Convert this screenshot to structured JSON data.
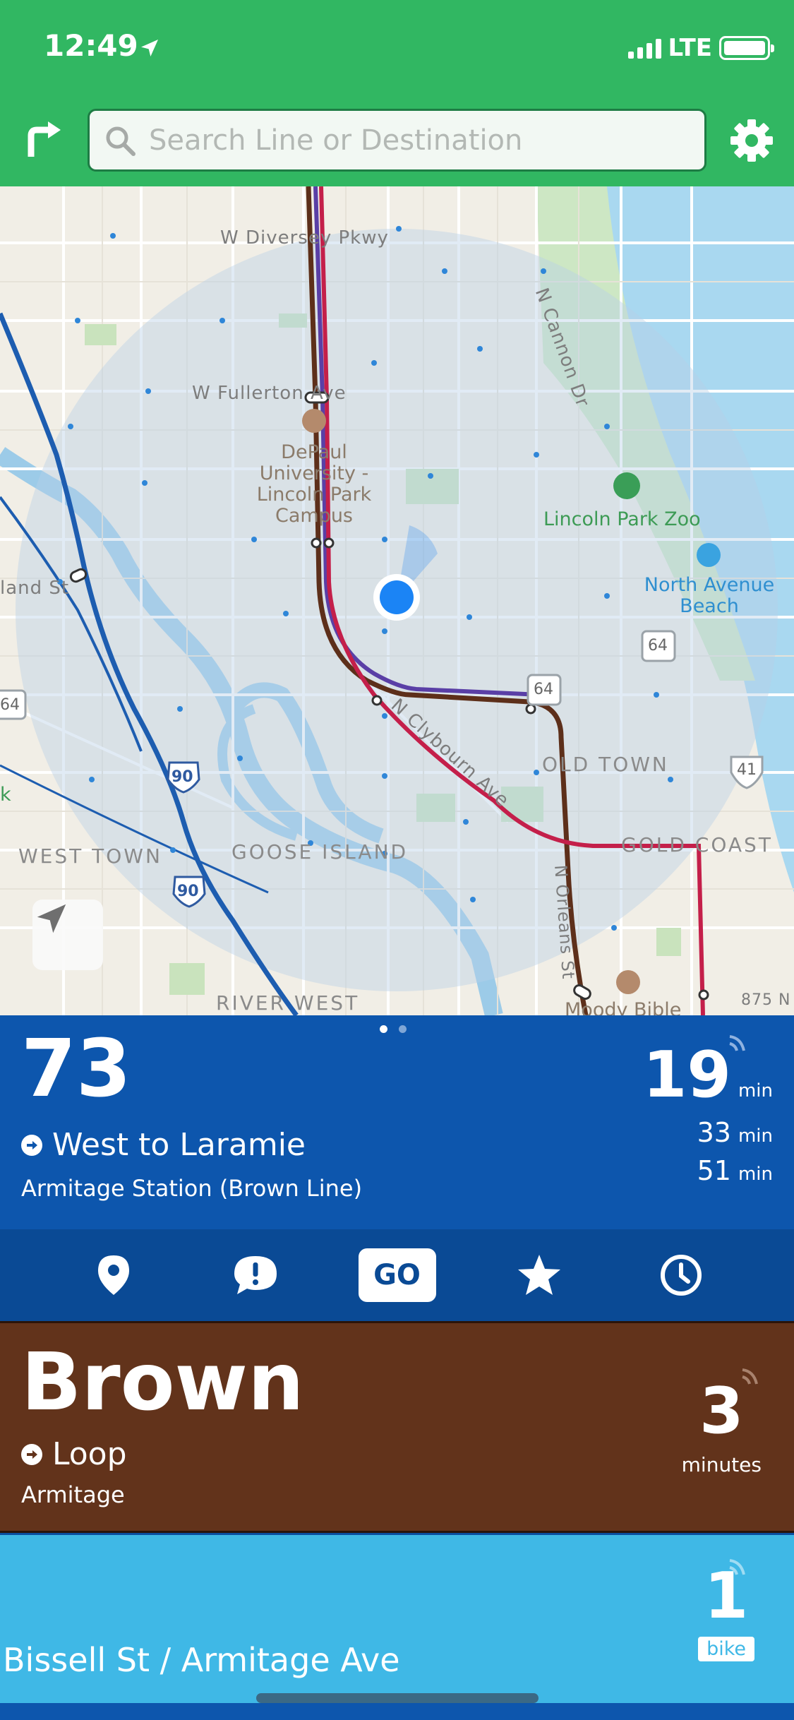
{
  "status_bar": {
    "time": "12:49",
    "network": "LTE"
  },
  "header": {
    "search_placeholder": "Search Line or Destination"
  },
  "map": {
    "street_labels": [
      "W Diversey Pkwy",
      "W Fullerton Ave",
      "N Cannon Dr",
      "land St",
      "N Clybourn Ave",
      "N Orleans St"
    ],
    "area_labels": [
      "WEST TOWN",
      "GOOSE ISLAND",
      "OLD TOWN",
      "GOLD COAST",
      "RIVER WEST",
      "k"
    ],
    "poi_labels": [
      "DePaul University - Lincoln Park Campus",
      "Lincoln Park Zoo",
      "North Avenue Beach",
      "Moody Bible",
      "875 N"
    ],
    "highway_shields": [
      "90",
      "90",
      "64",
      "64",
      "64",
      "41"
    ]
  },
  "bus_card": {
    "route_number": "73",
    "direction": "West to Laramie",
    "stop": "Armitage Station (Brown Line)",
    "arrivals": [
      {
        "value": "19",
        "unit": "min"
      },
      {
        "value": "33",
        "unit": "min"
      },
      {
        "value": "51",
        "unit": "min"
      }
    ],
    "page_count": 2,
    "active_page": 1
  },
  "actions": {
    "go_label": "GO"
  },
  "train_card": {
    "line": "Brown",
    "direction": "Loop",
    "stop": "Armitage",
    "eta_value": "3",
    "eta_unit": "minutes",
    "color": "#62331b"
  },
  "bike_card": {
    "station": "Bissell St / Armitage Ave",
    "count": "1",
    "unit": "bike",
    "color": "#3fb8e6"
  },
  "colors": {
    "header": "#31b762",
    "bus": "#0d56ad",
    "brown_line": "#62331b",
    "red_line": "#c41f4a",
    "purple_line": "#5a3fa6",
    "blue_line": "#1d5db0",
    "location_dot": "#1b84f5"
  }
}
